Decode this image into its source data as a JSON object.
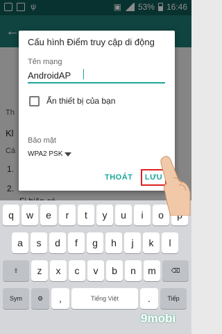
{
  "status_bar": {
    "battery": "53%",
    "time": "16:46"
  },
  "dialog": {
    "title": "Cấu hình Điểm truy cập di động",
    "network_label": "Tên mạng",
    "network_value": "AndroidAP",
    "hide_device_label": "Ẩn thiết bị của bạn",
    "security_label": "Bảo mật",
    "security_value": "WPA2 PSK",
    "exit_button": "THOÁT",
    "save_button": "LƯU"
  },
  "background": {
    "t1": "Th",
    "t2": "Kl",
    "t3": "Cá",
    "t4": "1.",
    "t5": "2.",
    "t6": "Fi hiện có"
  },
  "keyboard": {
    "row1": [
      "q",
      "w",
      "e",
      "r",
      "t",
      "y",
      "u",
      "i",
      "o",
      "p"
    ],
    "row2": [
      "a",
      "s",
      "d",
      "f",
      "g",
      "h",
      "j",
      "k",
      "l"
    ],
    "row3": [
      "z",
      "x",
      "c",
      "v",
      "b",
      "n",
      "m"
    ],
    "sym_key": "Sym",
    "language": "Tiếng Việt",
    "next_key": "Tiếp"
  },
  "watermark": "9mobi"
}
